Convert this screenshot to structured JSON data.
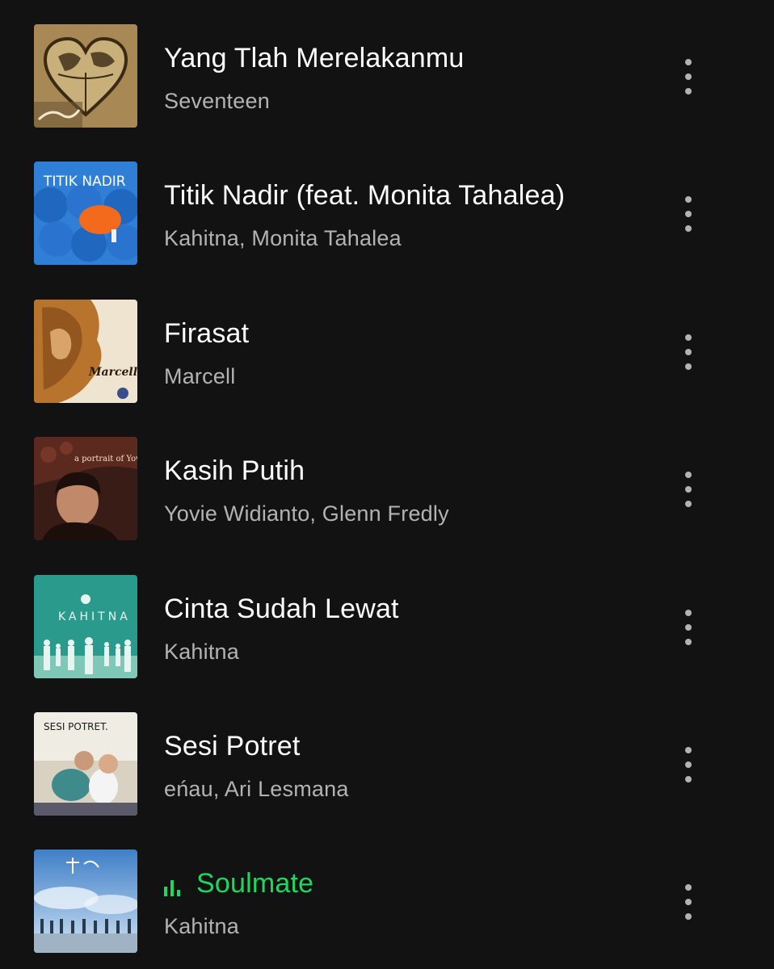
{
  "tracks": [
    {
      "title": "Yang Tlah Merelakanmu",
      "artist": "Seventeen",
      "cover_icon": "album-cover-heart-map",
      "playing": false
    },
    {
      "title": "Titik Nadir (feat. Monita Tahalea)",
      "artist": "Kahitna, Monita Tahalea",
      "cover_icon": "album-cover-umbrellas",
      "cover_text": "TITIK NADIR",
      "playing": false
    },
    {
      "title": "Firasat",
      "artist": "Marcell",
      "cover_icon": "album-cover-portrait",
      "cover_text": "Marcell",
      "playing": false
    },
    {
      "title": "Kasih Putih",
      "artist": "Yovie Widianto, Glenn Fredly",
      "cover_icon": "album-cover-portrait-dark",
      "cover_text": "a portrait of Yovie",
      "playing": false
    },
    {
      "title": "Cinta Sudah Lewat",
      "artist": "Kahitna",
      "cover_icon": "album-cover-silhouettes",
      "cover_text": "KAHITNA",
      "playing": false
    },
    {
      "title": "Sesi Potret",
      "artist": "eńau, Ari Lesmana",
      "cover_icon": "album-cover-photo",
      "cover_text": "SESI POTRET.",
      "playing": false
    },
    {
      "title": "Soulmate",
      "artist": "Kahitna",
      "cover_icon": "album-cover-sky-group",
      "playing": true
    }
  ],
  "colors": {
    "background": "#121212",
    "title": "#ffffff",
    "subtitle": "#b3b3b3",
    "accent": "#1ed760"
  }
}
